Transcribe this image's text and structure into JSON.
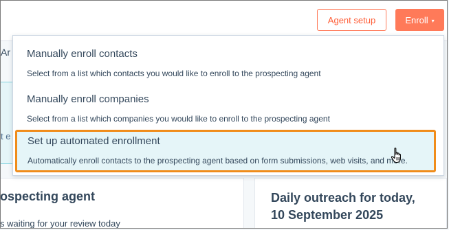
{
  "header": {
    "agent_setup_label": "Agent setup",
    "enroll_label": "Enroll",
    "enroll_caret": "▾"
  },
  "background": {
    "left_fragment_top": "Ar",
    "left_fragment_mid": "t e",
    "left_card_title": "ospecting agent",
    "left_card_subtitle": "s waiting for your review today",
    "right_card_title_line1": "Daily outreach for today,",
    "right_card_title_line2": "10 September 2025"
  },
  "menu": {
    "items": [
      {
        "title": "Manually enroll contacts",
        "description": "Select from a list which contacts you would like to enroll to the prospecting agent"
      },
      {
        "title": "Manually enroll companies",
        "description": "Select from a list which companies you would like to enroll to the prospecting agent"
      },
      {
        "title": "Set up automated enrollment",
        "description": "Automatically enroll contacts to the prospecting agent based on form submissions, web visits, and more."
      }
    ]
  },
  "colors": {
    "accent": "#ff7a59",
    "highlight_border": "#f08c1a",
    "highlight_bg": "#e5f5f8"
  }
}
